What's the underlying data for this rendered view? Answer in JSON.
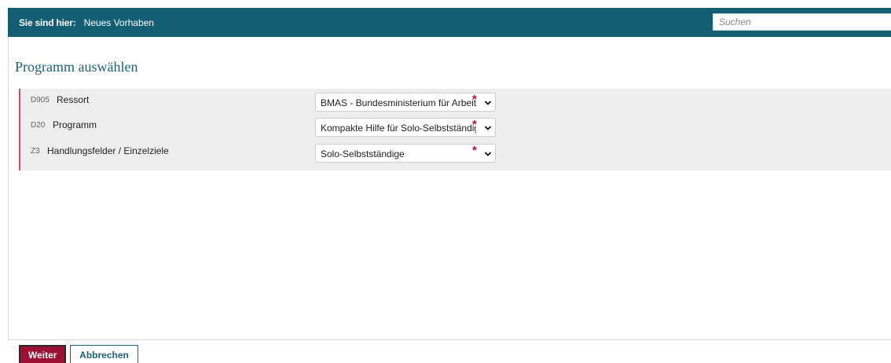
{
  "breadcrumb": {
    "label": "Sie sind hier:",
    "current": "Neues Vorhaben"
  },
  "search": {
    "placeholder": "Suchen"
  },
  "page": {
    "title": "Programm auswählen"
  },
  "form": {
    "fields": [
      {
        "code": "D905",
        "label": "Ressort",
        "value": "BMAS - Bundesministerium für Arbeit und Soziales",
        "required_mark": "*"
      },
      {
        "code": "D20",
        "label": "Programm",
        "value": "Kompakte Hilfe für Solo-Selbstständige",
        "required_mark": "*"
      },
      {
        "code": "Z3",
        "label": "Handlungsfelder / Einzelziele",
        "value": "Solo-Selbstständige",
        "required_mark": "*"
      }
    ]
  },
  "footer": {
    "next_label": "Weiter",
    "cancel_label": "Abbrechen"
  },
  "colors": {
    "header_bg": "#135e73",
    "title_color": "#1e6277",
    "primary_button": "#9c1034",
    "required_star": "#b5103b"
  }
}
